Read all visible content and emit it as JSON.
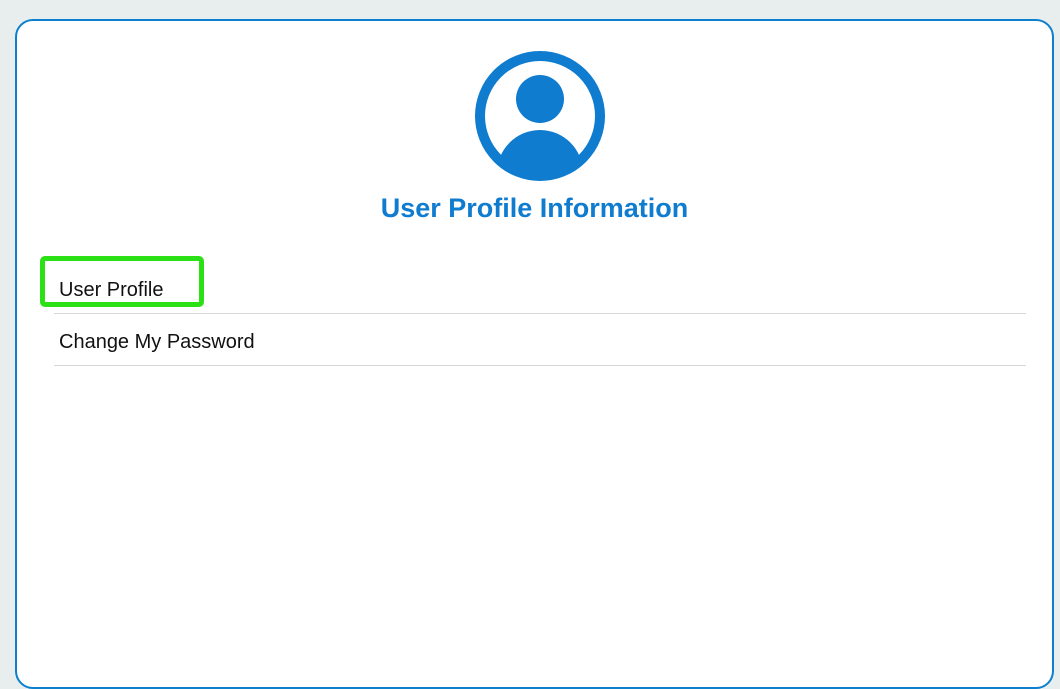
{
  "page": {
    "title": "User Profile Information",
    "avatar_icon": "user-circle-icon"
  },
  "menu": {
    "items": [
      {
        "label": "User Profile",
        "highlighted": true
      },
      {
        "label": "Change My Password",
        "highlighted": false
      }
    ]
  },
  "colors": {
    "accent": "#0f7ccf",
    "highlight": "#2be015",
    "background": "#e8eeee"
  }
}
